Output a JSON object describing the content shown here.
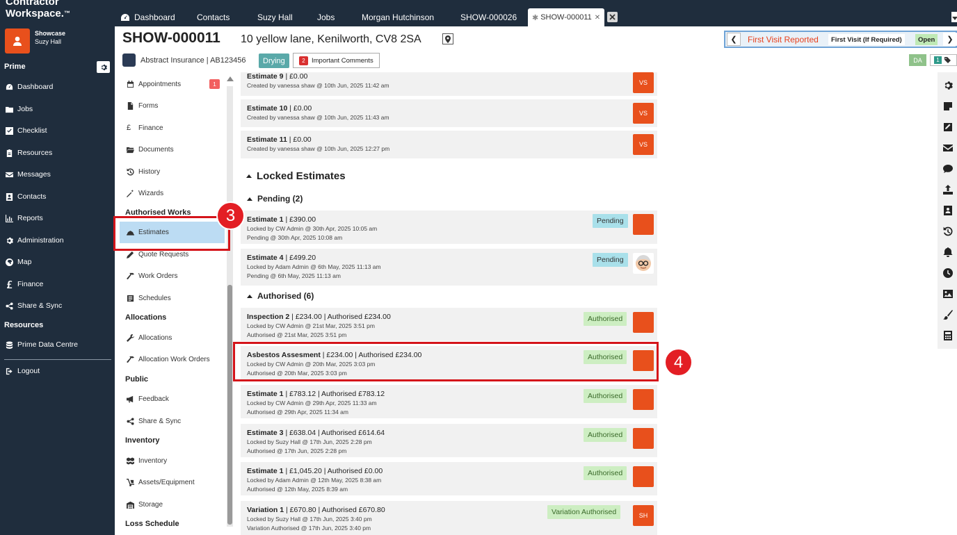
{
  "brand": {
    "line1": "Contractor",
    "line2": "Workspace."
  },
  "account": {
    "org": "Showcase",
    "user": "Suzy Hall"
  },
  "sidebar": {
    "prime_heading": "Prime",
    "items": [
      {
        "label": "Dashboard",
        "icon": "dashboard-icon"
      },
      {
        "label": "Jobs",
        "icon": "folder-icon"
      },
      {
        "label": "Checklist",
        "icon": "checkbox-icon"
      },
      {
        "label": "Resources",
        "icon": "clipboard-icon"
      },
      {
        "label": "Messages",
        "icon": "envelope-icon"
      },
      {
        "label": "Contacts",
        "icon": "contact-card-icon"
      },
      {
        "label": "Reports",
        "icon": "bar-chart-icon"
      },
      {
        "label": "Administration",
        "icon": "gear-icon"
      },
      {
        "label": "Map",
        "icon": "globe-icon"
      },
      {
        "label": "Finance",
        "icon": "pound-icon"
      },
      {
        "label": "Share & Sync",
        "icon": "share-icon"
      }
    ],
    "resources_heading": "Resources",
    "prime_data_centre": "Prime Data Centre",
    "logout": "Logout"
  },
  "tabs": [
    "Dashboard",
    "Contacts",
    "Suzy Hall",
    "Jobs",
    "Morgan Hutchinson",
    "SHOW-000026",
    "SHOW-000011"
  ],
  "job": {
    "id": "SHOW-000011",
    "address": "10 yellow lane, Kenilworth, CV8 2SA",
    "client": "Abstract Insurance | AB123456",
    "stage": "Drying",
    "important_count": "2",
    "important_label": "Important Comments"
  },
  "status_bar": {
    "status": "First Visit Reported",
    "visit": "First Visit (If Required)",
    "state": "Open"
  },
  "assignee": "DA",
  "tag_count": "1",
  "subnav": {
    "appointments": "Appointments",
    "appointments_badge": "1",
    "forms": "Forms",
    "finance": "Finance",
    "documents": "Documents",
    "history": "History",
    "wizards": "Wizards",
    "authorised_works": "Authorised Works",
    "estimates": "Estimates",
    "quote_requests": "Quote Requests",
    "work_orders": "Work Orders",
    "schedules": "Schedules",
    "allocations_heading": "Allocations",
    "allocations": "Allocations",
    "allocation_work_orders": "Allocation Work Orders",
    "public_heading": "Public",
    "feedback": "Feedback",
    "share_sync": "Share & Sync",
    "inventory_heading": "Inventory",
    "inventory": "Inventory",
    "assets": "Assets/Equipment",
    "storage": "Storage",
    "loss_schedule": "Loss Schedule"
  },
  "open_estimates": [
    {
      "name": "Estimate 9",
      "amount": " | £0.00",
      "created": "Created by vanessa shaw @ 10th Jun, 2025 11:42 am",
      "initials": "VS"
    },
    {
      "name": "Estimate 10",
      "amount": " | £0.00",
      "created": "Created by vanessa shaw @ 10th Jun, 2025 11:43 am",
      "initials": "VS"
    },
    {
      "name": "Estimate 11",
      "amount": " | £0.00",
      "created": "Created by vanessa shaw @ 10th Jun, 2025 12:27 pm",
      "initials": "VS"
    }
  ],
  "locked_heading": "Locked Estimates",
  "pending_heading": "Pending (2)",
  "pending": [
    {
      "name": "Estimate 1",
      "amount": " | £390.00",
      "locked": "Locked by CW Admin @ 30th Apr, 2025 10:05 am",
      "status_line": "Pending @ 30th Apr, 2025 10:08 am",
      "badge": "Pending"
    },
    {
      "name": "Estimate 4",
      "amount": " | £499.20",
      "locked": "Locked by Adam Admin @ 6th May, 2025 11:13 am",
      "status_line": "Pending @ 6th May, 2025 11:13 am",
      "badge": "Pending"
    }
  ],
  "authorised_heading": "Authorised (6)",
  "authorised": [
    {
      "name": "Inspection 2",
      "amount": " | £234.00 | Authorised £234.00",
      "locked": "Locked by CW Admin @ 21st Mar, 2025 3:51 pm",
      "status_line": "Authorised @ 21st Mar, 2025 3:51 pm",
      "badge": "Authorised",
      "initials": ""
    },
    {
      "name": "Asbestos Assesment",
      "amount": " | £234.00 | Authorised £234.00",
      "locked": "Locked by CW Admin @ 20th Mar, 2025 3:03 pm",
      "status_line": "Authorised @ 20th Mar, 2025 3:03 pm",
      "badge": "Authorised",
      "initials": ""
    },
    {
      "name": "Estimate 1",
      "amount": " | £783.12 | Authorised £783.12",
      "locked": "Locked by CW Admin @ 29th Apr, 2025 11:33 am",
      "status_line": "Authorised @ 29th Apr, 2025 11:34 am",
      "badge": "Authorised",
      "initials": ""
    },
    {
      "name": "Estimate 3",
      "amount": " | £638.04 | Authorised £614.64",
      "locked": "Locked by Suzy Hall @ 17th Jun, 2025 2:28 pm",
      "status_line": "Authorised @ 17th Jun, 2025 2:28 pm",
      "badge": "Authorised",
      "initials": ""
    },
    {
      "name": "Estimate 1",
      "amount": " | £1,045.20 | Authorised £0.00",
      "locked": "Locked by Adam Admin @ 12th May, 2025 8:38 am",
      "status_line": "Authorised @ 12th May, 2025 8:39 am",
      "badge": "Authorised",
      "initials": ""
    },
    {
      "name": "Variation 1",
      "amount": " | £670.80 | Authorised £670.80",
      "locked": "Locked by Suzy Hall @ 17th Jun, 2025 3:40 pm",
      "status_line": "Variation Authorised @ 17th Jun, 2025 3:40 pm",
      "badge": "Variation Authorised",
      "initials": "SH"
    }
  ],
  "callouts": {
    "step3": "3",
    "step4": "4"
  },
  "colors": {
    "sidebar_bg": "#1f2d3d",
    "accent": "#e8501c",
    "highlight": "#d4141a",
    "selected": "#bcdcf3"
  }
}
